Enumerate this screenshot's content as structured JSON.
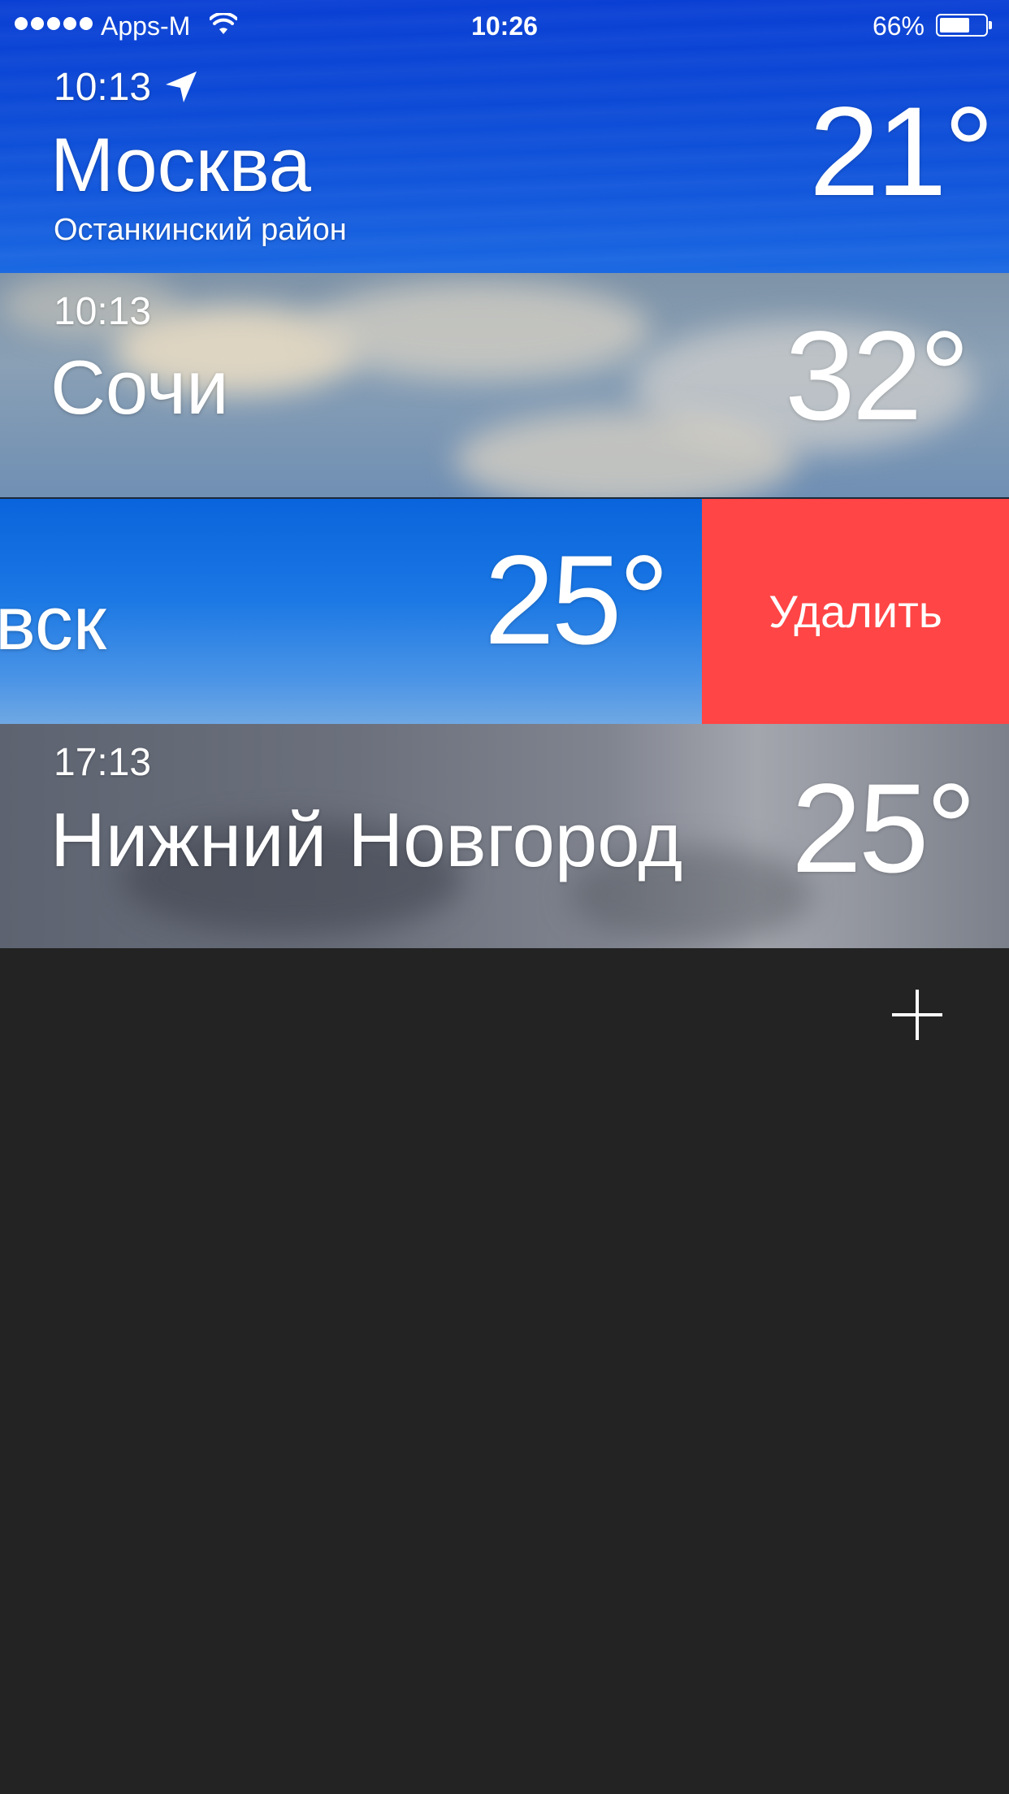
{
  "status_bar": {
    "carrier": "Apps-M",
    "time": "10:26",
    "battery_percent": "66%",
    "battery_level": 0.66,
    "signal_bars": 5
  },
  "cities": [
    {
      "time": "10:13",
      "city": "Москва",
      "district": "Останкинский район",
      "temperature": "21°",
      "current_location": true
    },
    {
      "time": "10:13",
      "city": "Сочи",
      "temperature": "32°"
    },
    {
      "city_partial": "вск",
      "temperature": "25°",
      "delete_label": "Удалить"
    },
    {
      "time": "17:13",
      "city": "Нижний Новгород",
      "temperature": "25°"
    }
  ],
  "colors": {
    "delete": "#ff4545",
    "background": "#232323"
  },
  "icons": {
    "location": "location-arrow-icon",
    "add": "plus-icon",
    "wifi": "wifi-icon",
    "battery": "battery-icon"
  }
}
